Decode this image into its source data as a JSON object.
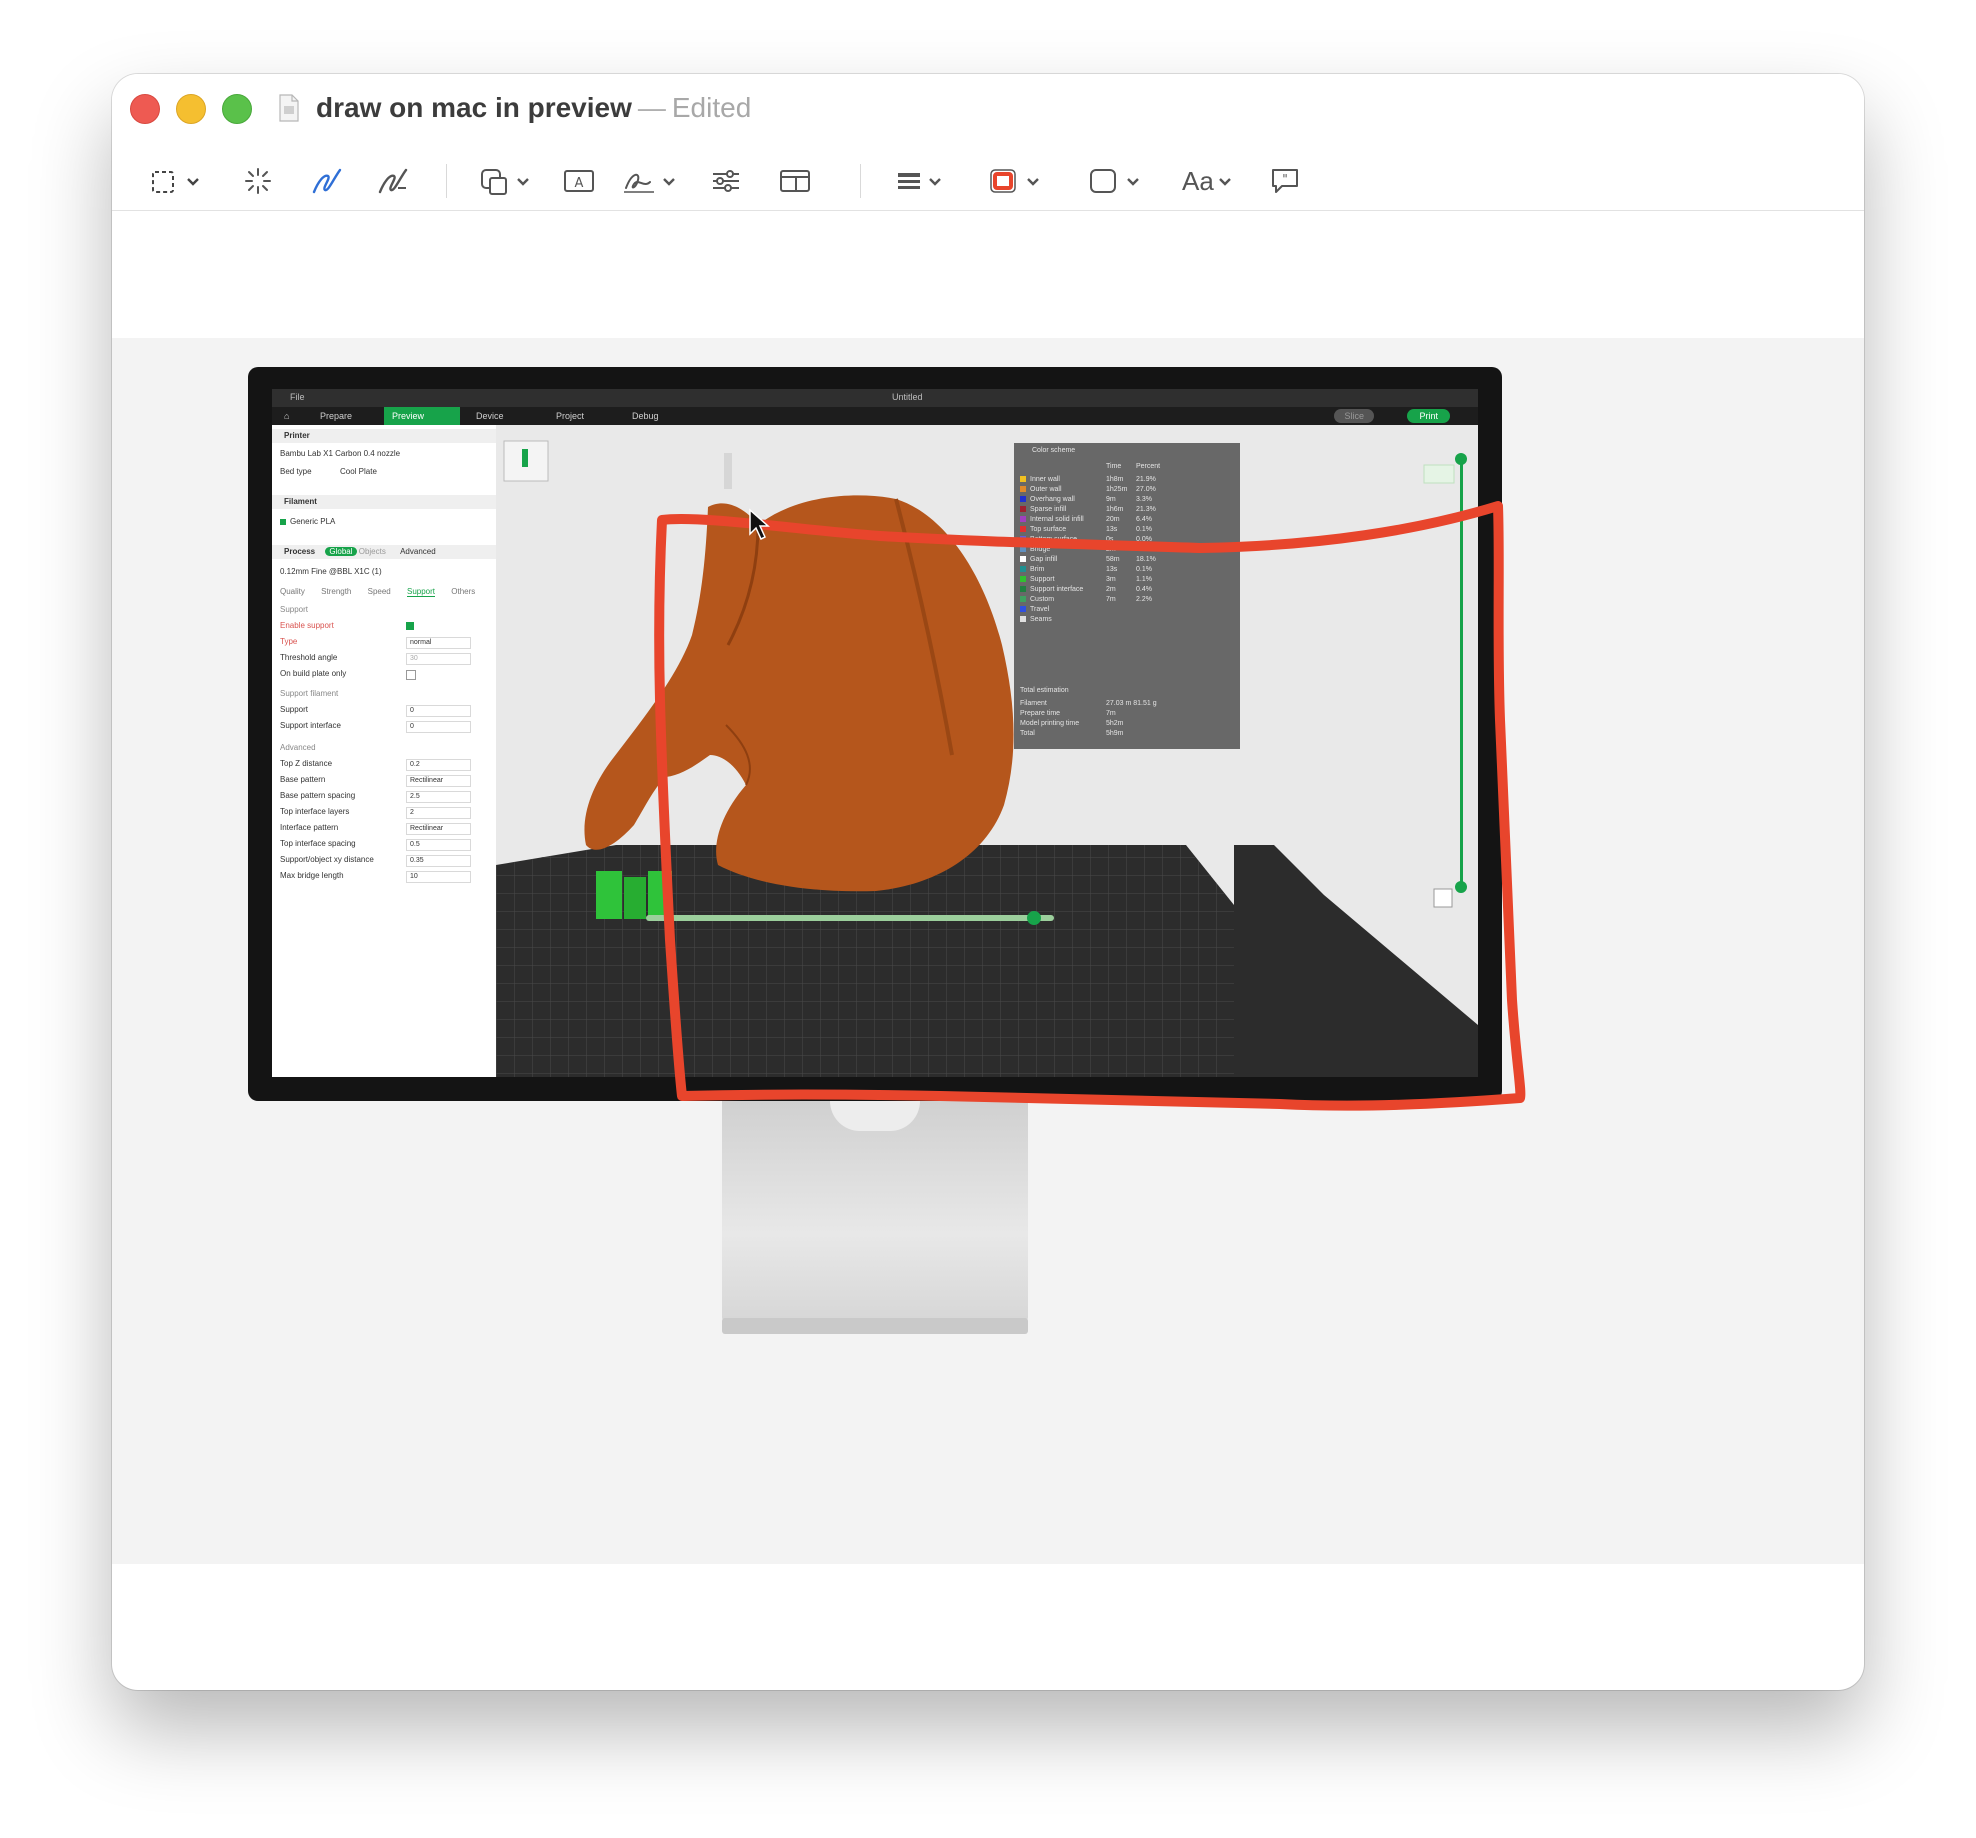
{
  "window": {
    "title": "draw on mac in preview",
    "separator": "—",
    "status": "Edited"
  },
  "toolbar": {
    "items": [
      "selection-tool",
      "instant-alpha",
      "sketch",
      "draw",
      "shapes",
      "text",
      "sign",
      "adjust-color",
      "adjust-size",
      "shape-style",
      "border-color",
      "fill-color",
      "text-style",
      "annotate"
    ],
    "text_style_label": "Aa",
    "border_color": "#e8452c"
  },
  "slicer": {
    "window_title": "Untitled",
    "menu": [
      "File"
    ],
    "tabs": [
      "Prepare",
      "Preview",
      "Device",
      "Project",
      "Debug"
    ],
    "active_tab": "Preview",
    "slice_label": "Slice",
    "print_label": "Print",
    "accent": "#17a34a",
    "model_color": "#b5561c",
    "annotation_color": "#e8452c",
    "left_panel": {
      "printer_header": "Printer",
      "printer_value": "Bambu Lab X1 Carbon 0.4 nozzle",
      "bed_type_label": "Bed type",
      "bed_type_value": "Cool Plate",
      "filament_header": "Filament",
      "filament_value": "Generic PLA",
      "process_header": "Process",
      "process_global": "Global",
      "process_objects": "Objects",
      "process_advanced": "Advanced",
      "process_preset": "0.12mm Fine @BBL X1C (1)",
      "subtabs": [
        "Quality",
        "Strength",
        "Speed",
        "Support",
        "Others"
      ],
      "active_subtab": "Support",
      "support_section": "Support",
      "support_rows": [
        {
          "label": "Enable support",
          "value": ""
        },
        {
          "label": "Type",
          "value": "normal"
        },
        {
          "label": "Threshold angle",
          "value": "30"
        },
        {
          "label": "On build plate only",
          "value": ""
        }
      ],
      "support_filament_section": "Support filament",
      "support_filament_rows": [
        {
          "label": "Support",
          "value": "0"
        },
        {
          "label": "Support interface",
          "value": "0"
        }
      ],
      "advanced_section": "Advanced",
      "advanced_rows": [
        {
          "label": "Top Z distance",
          "value": "0.2"
        },
        {
          "label": "Base pattern",
          "value": "Rectilinear"
        },
        {
          "label": "Base pattern spacing",
          "value": "2.5"
        },
        {
          "label": "Top interface layers",
          "value": "2"
        },
        {
          "label": "Interface pattern",
          "value": "Rectilinear"
        },
        {
          "label": "Top interface spacing",
          "value": "0.5"
        },
        {
          "label": "Support/object xy distance",
          "value": "0.35"
        },
        {
          "label": "Max bridge length",
          "value": "10"
        }
      ]
    },
    "legend": {
      "header": "Color scheme",
      "col_time": "Time",
      "col_percent": "Percent",
      "rows": [
        {
          "name": "Inner wall",
          "time": "1h8m",
          "percent": "21.9%",
          "color": "#f0c020"
        },
        {
          "name": "Outer wall",
          "time": "1h25m",
          "percent": "27.0%",
          "color": "#e08a2a"
        },
        {
          "name": "Overhang wall",
          "time": "9m",
          "percent": "3.3%",
          "color": "#2030d0"
        },
        {
          "name": "Sparse infill",
          "time": "1h6m",
          "percent": "21.3%",
          "color": "#a02030"
        },
        {
          "name": "Internal solid infill",
          "time": "20m",
          "percent": "6.4%",
          "color": "#a040c0"
        },
        {
          "name": "Top surface",
          "time": "13s",
          "percent": "0.1%",
          "color": "#e03030"
        },
        {
          "name": "Bottom surface",
          "time": "0s",
          "percent": "0.0%",
          "color": "#6060e0"
        },
        {
          "name": "Bridge",
          "time": "2m",
          "percent": "0.5%",
          "color": "#6090c0"
        },
        {
          "name": "Gap infill",
          "time": "58m",
          "percent": "18.1%",
          "color": "#ffffff"
        },
        {
          "name": "Brim",
          "time": "13s",
          "percent": "0.1%",
          "color": "#209090"
        },
        {
          "name": "Support",
          "time": "3m",
          "percent": "1.1%",
          "color": "#30c030"
        },
        {
          "name": "Support interface",
          "time": "2m",
          "percent": "0.4%",
          "color": "#208040"
        },
        {
          "name": "Custom",
          "time": "7m",
          "percent": "2.2%",
          "color": "#40a060"
        },
        {
          "name": "Travel",
          "time": "",
          "percent": "",
          "color": "#3050e0"
        },
        {
          "name": "Seams",
          "time": "",
          "percent": "",
          "color": "#e0e0e0"
        }
      ],
      "total_header": "Total estimation",
      "totals": [
        {
          "label": "Filament",
          "value": "27.03 m   81.51 g"
        },
        {
          "label": "Prepare time",
          "value": "7m"
        },
        {
          "label": "Model printing time",
          "value": "5h2m"
        },
        {
          "label": "Total",
          "value": "5h9m"
        }
      ]
    }
  }
}
